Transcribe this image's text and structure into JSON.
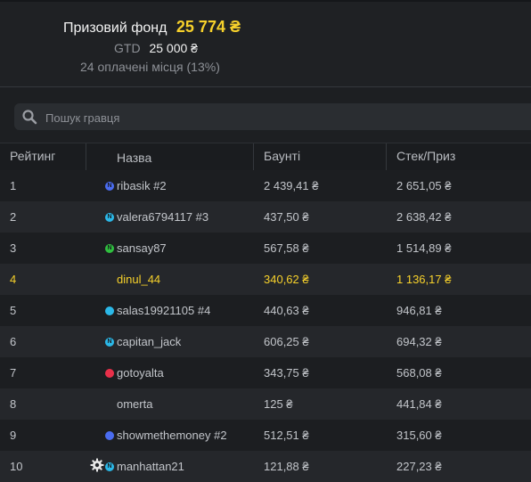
{
  "summary": {
    "prize_label": "Призовий фонд",
    "prize_amount": "25 774 ₴",
    "gtd_label": "GTD",
    "gtd_amount": "25 000 ₴",
    "paid_places": "24 оплачені місця (13%)"
  },
  "search": {
    "placeholder": "Пошук гравця"
  },
  "table": {
    "headers": {
      "rank": "Рейтинг",
      "name": "Назва",
      "bounty": "Баунті",
      "stack": "Стек/Приз"
    },
    "rows": [
      {
        "rank": "1",
        "name": "ribasik #2",
        "bounty": "2 439,41 ₴",
        "stack": "2 651,05 ₴",
        "badge": "N",
        "badge_color": "#4a6cf0"
      },
      {
        "rank": "2",
        "name": "valera6794117 #3",
        "bounty": "437,50 ₴",
        "stack": "2 638,42 ₴",
        "badge": "N",
        "badge_color": "#2bb8e8"
      },
      {
        "rank": "3",
        "name": "sansay87",
        "bounty": "567,58 ₴",
        "stack": "1 514,89 ₴",
        "badge": "N",
        "badge_color": "#2fbf3f"
      },
      {
        "rank": "4",
        "name": "dinul_44",
        "bounty": "340,62 ₴",
        "stack": "1 136,17 ₴",
        "badge": "",
        "badge_color": ""
      },
      {
        "rank": "5",
        "name": "salas19921105 #4",
        "bounty": "440,63 ₴",
        "stack": "946,81 ₴",
        "badge": "",
        "badge_color": "#2bb8e8"
      },
      {
        "rank": "6",
        "name": "capitan_jack",
        "bounty": "606,25 ₴",
        "stack": "694,32 ₴",
        "badge": "N",
        "badge_color": "#2bb8e8"
      },
      {
        "rank": "7",
        "name": "gotoyalta",
        "bounty": "343,75 ₴",
        "stack": "568,08 ₴",
        "badge": "",
        "badge_color": "#e8304a"
      },
      {
        "rank": "8",
        "name": "omerta",
        "bounty": "125 ₴",
        "stack": "441,84 ₴",
        "badge": "",
        "badge_color": ""
      },
      {
        "rank": "9",
        "name": "showmethemoney #2",
        "bounty": "512,51 ₴",
        "stack": "315,60 ₴",
        "badge": "",
        "badge_color": "#4a6cf0"
      },
      {
        "rank": "10",
        "name": "manhattan21",
        "bounty": "121,88 ₴",
        "stack": "227,23 ₴",
        "badge": "N",
        "badge_color": "#2bb8e8"
      }
    ]
  },
  "colors": {
    "accent": "#f7d12b",
    "background": "#1d1f22",
    "row_alt": "#25272b"
  },
  "icons": {
    "search": "search-icon",
    "gear": "gear-icon"
  }
}
